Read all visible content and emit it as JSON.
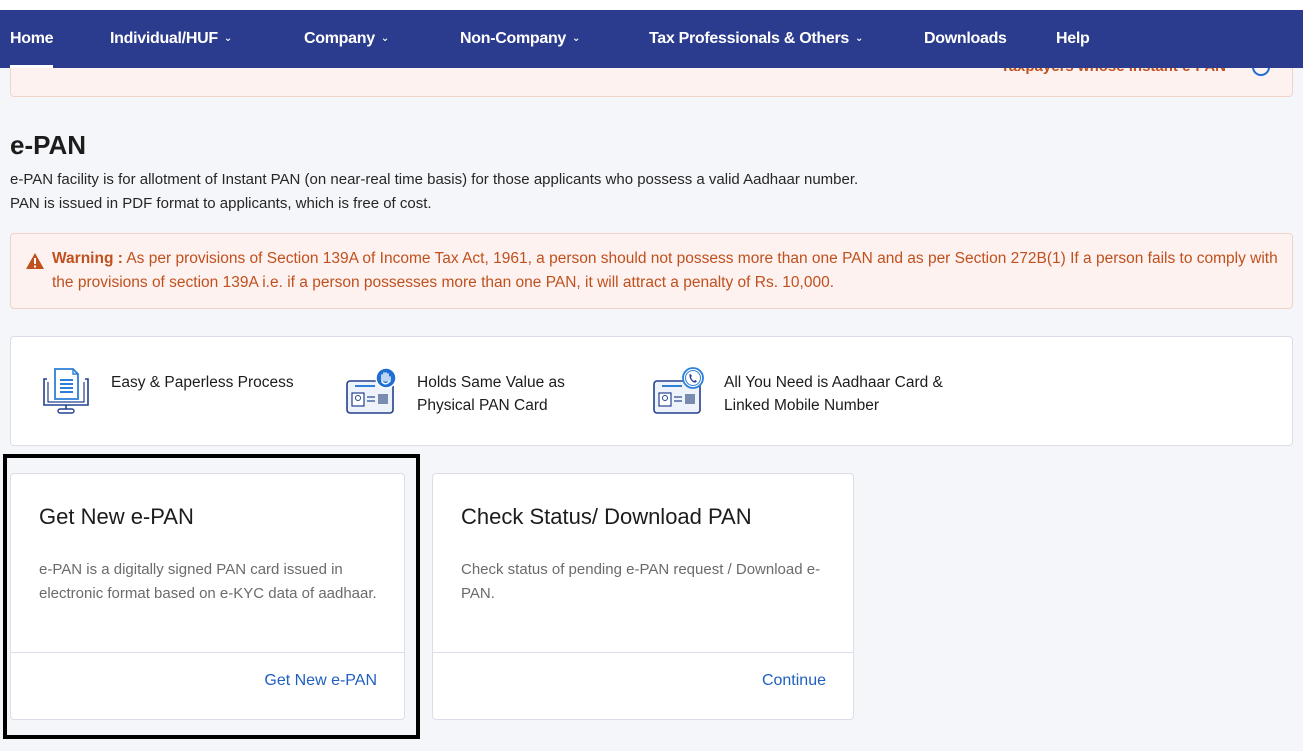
{
  "nav": {
    "items": [
      {
        "label": "Home",
        "active": true,
        "dropdown": false
      },
      {
        "label": "Individual/HUF",
        "dropdown": true
      },
      {
        "label": "Company",
        "dropdown": true
      },
      {
        "label": "Non-Company",
        "dropdown": true
      },
      {
        "label": "Tax Professionals & Others",
        "dropdown": true
      },
      {
        "label": "Downloads",
        "dropdown": false
      },
      {
        "label": "Help",
        "dropdown": false
      }
    ],
    "chevron": "⌄"
  },
  "banner": {
    "text": "Taxpayers whose instant e-PAN",
    "icon": "info-icon"
  },
  "page": {
    "title": "e-PAN",
    "intro": "e-PAN facility is for allotment of Instant PAN (on near-real time basis) for those applicants who possess a valid Aadhaar number. PAN is issued in PDF format to applicants, which is free of cost."
  },
  "warning": {
    "label": "Warning :",
    "text": " As per provisions of Section 139A of Income Tax Act, 1961, a person should not possess more than one PAN and as per Section 272B(1) If a person fails to comply with the provisions of section 139A i.e. if a person possesses more than one PAN, it will attract a penalty of Rs. 10,000.",
    "icon": "warning-triangle-icon"
  },
  "features": [
    {
      "icon": "paperless-monitor-icon",
      "line1": "Easy & Paperless Process",
      "line2": ""
    },
    {
      "icon": "pan-card-hand-icon",
      "line1": "Holds Same Value as",
      "line2": "Physical PAN Card"
    },
    {
      "icon": "aadhaar-phone-icon",
      "line1": "All You Need is Aadhaar Card &",
      "line2": "Linked Mobile Number"
    }
  ],
  "cards": [
    {
      "title": "Get New e-PAN",
      "description": "e-PAN is a digitally signed PAN card issued in electronic format based on e-KYC data of aadhaar.",
      "action": "Get New e-PAN"
    },
    {
      "title": "Check Status/ Download PAN",
      "description": "Check status of pending e-PAN request / Download e-PAN.",
      "action": "Continue"
    }
  ],
  "colors": {
    "nav_bg": "#2b3b8d",
    "warning_text": "#c0501e",
    "warning_bg": "#fdf2ef",
    "link": "#1f5fbf",
    "page_bg": "#f5f6fa"
  }
}
